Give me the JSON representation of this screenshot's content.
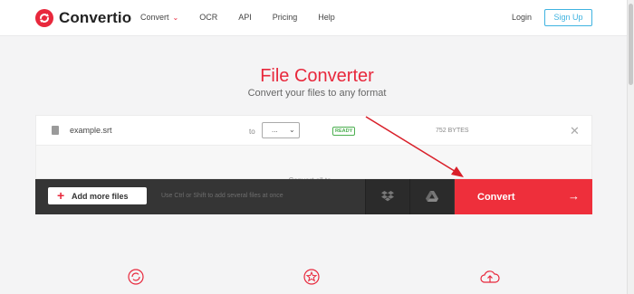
{
  "brand": {
    "name": "Convertio",
    "accent": "#e8283c"
  },
  "nav": {
    "items": [
      {
        "label": "Convert",
        "has_dropdown": true
      },
      {
        "label": "OCR"
      },
      {
        "label": "API"
      },
      {
        "label": "Pricing"
      },
      {
        "label": "Help"
      }
    ],
    "login": "Login",
    "signup": "Sign Up"
  },
  "hero": {
    "title": "File Converter",
    "subtitle": "Convert your files to any format"
  },
  "file": {
    "name": "example.srt",
    "to_label": "to",
    "format_value": "...",
    "status": "READY",
    "size": "752 BYTES"
  },
  "convert_all": {
    "label": "Convert all to"
  },
  "actions": {
    "add_files": "Add more files",
    "hint": "Use Ctrl or Shift to add several files at once",
    "convert": "Convert",
    "convert_color": "#ee2f3b"
  },
  "icons": {
    "dropbox": "dropbox-icon",
    "google_drive": "google-drive-icon",
    "remove": "close-icon",
    "arrow_right": "arrow-right-icon"
  }
}
